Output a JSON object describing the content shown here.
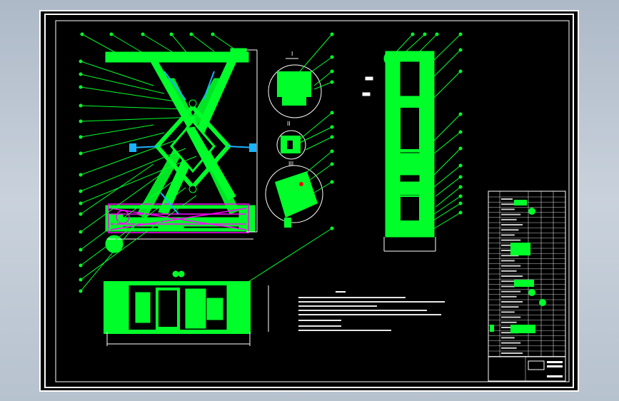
{
  "app": {
    "background": "#b9c3cf",
    "sheet_color": "#000000",
    "frame_color": "#ffffff"
  },
  "colors": {
    "part": "#00ff2a",
    "leader": "#00ff2a",
    "linkage": "#ff00ff",
    "accent_blue": "#1ab3ff",
    "accent_red": "#ff0000",
    "frame_line": "#ffffff"
  },
  "drawing": {
    "detail_labels": [
      "I",
      "II",
      "III"
    ],
    "icons": [
      "circle-view-icon"
    ]
  }
}
